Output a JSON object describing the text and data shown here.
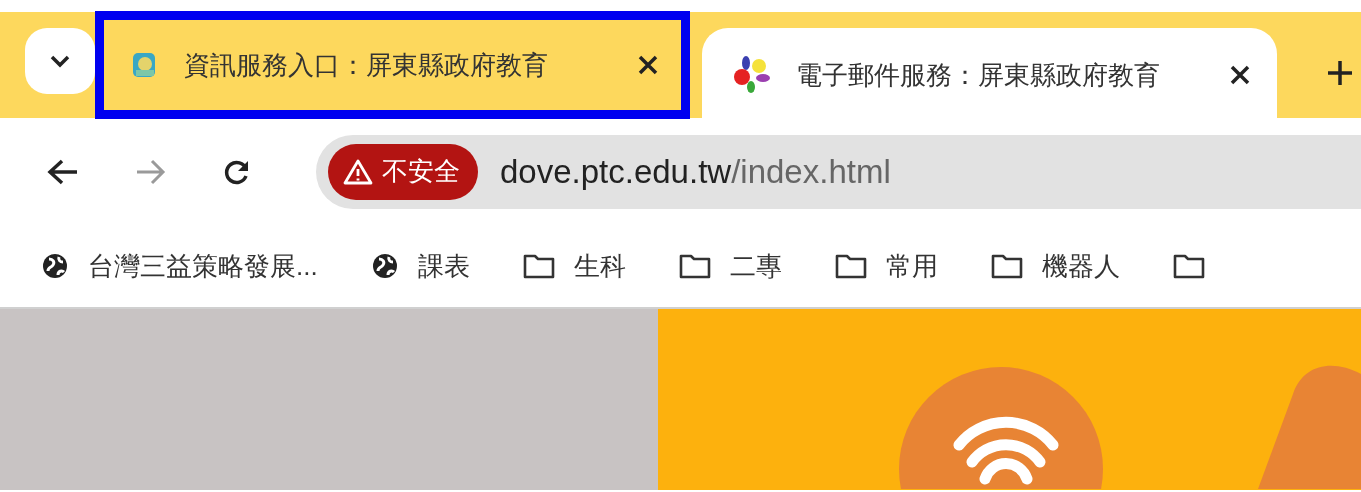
{
  "tab_strip": {
    "tabs": [
      {
        "title": "資訊服務入口：屏東縣政府教育",
        "kind": "portal",
        "selected": false,
        "highlighted": true
      },
      {
        "title": "電子郵件服務：屏東縣政府教育",
        "kind": "flower",
        "selected": true,
        "highlighted": false
      }
    ]
  },
  "toolbar": {
    "forward_disabled": true,
    "security_chip": "不安全",
    "url_host": "dove.ptc.edu.tw",
    "url_path": "/index.html"
  },
  "bookmarks": [
    {
      "kind": "site",
      "label": "台灣三益策略發展..."
    },
    {
      "kind": "site",
      "label": "課表"
    },
    {
      "kind": "folder",
      "label": "生科"
    },
    {
      "kind": "folder",
      "label": "二專"
    },
    {
      "kind": "folder",
      "label": "常用"
    },
    {
      "kind": "folder",
      "label": "機器人"
    },
    {
      "kind": "folder"
    }
  ]
}
